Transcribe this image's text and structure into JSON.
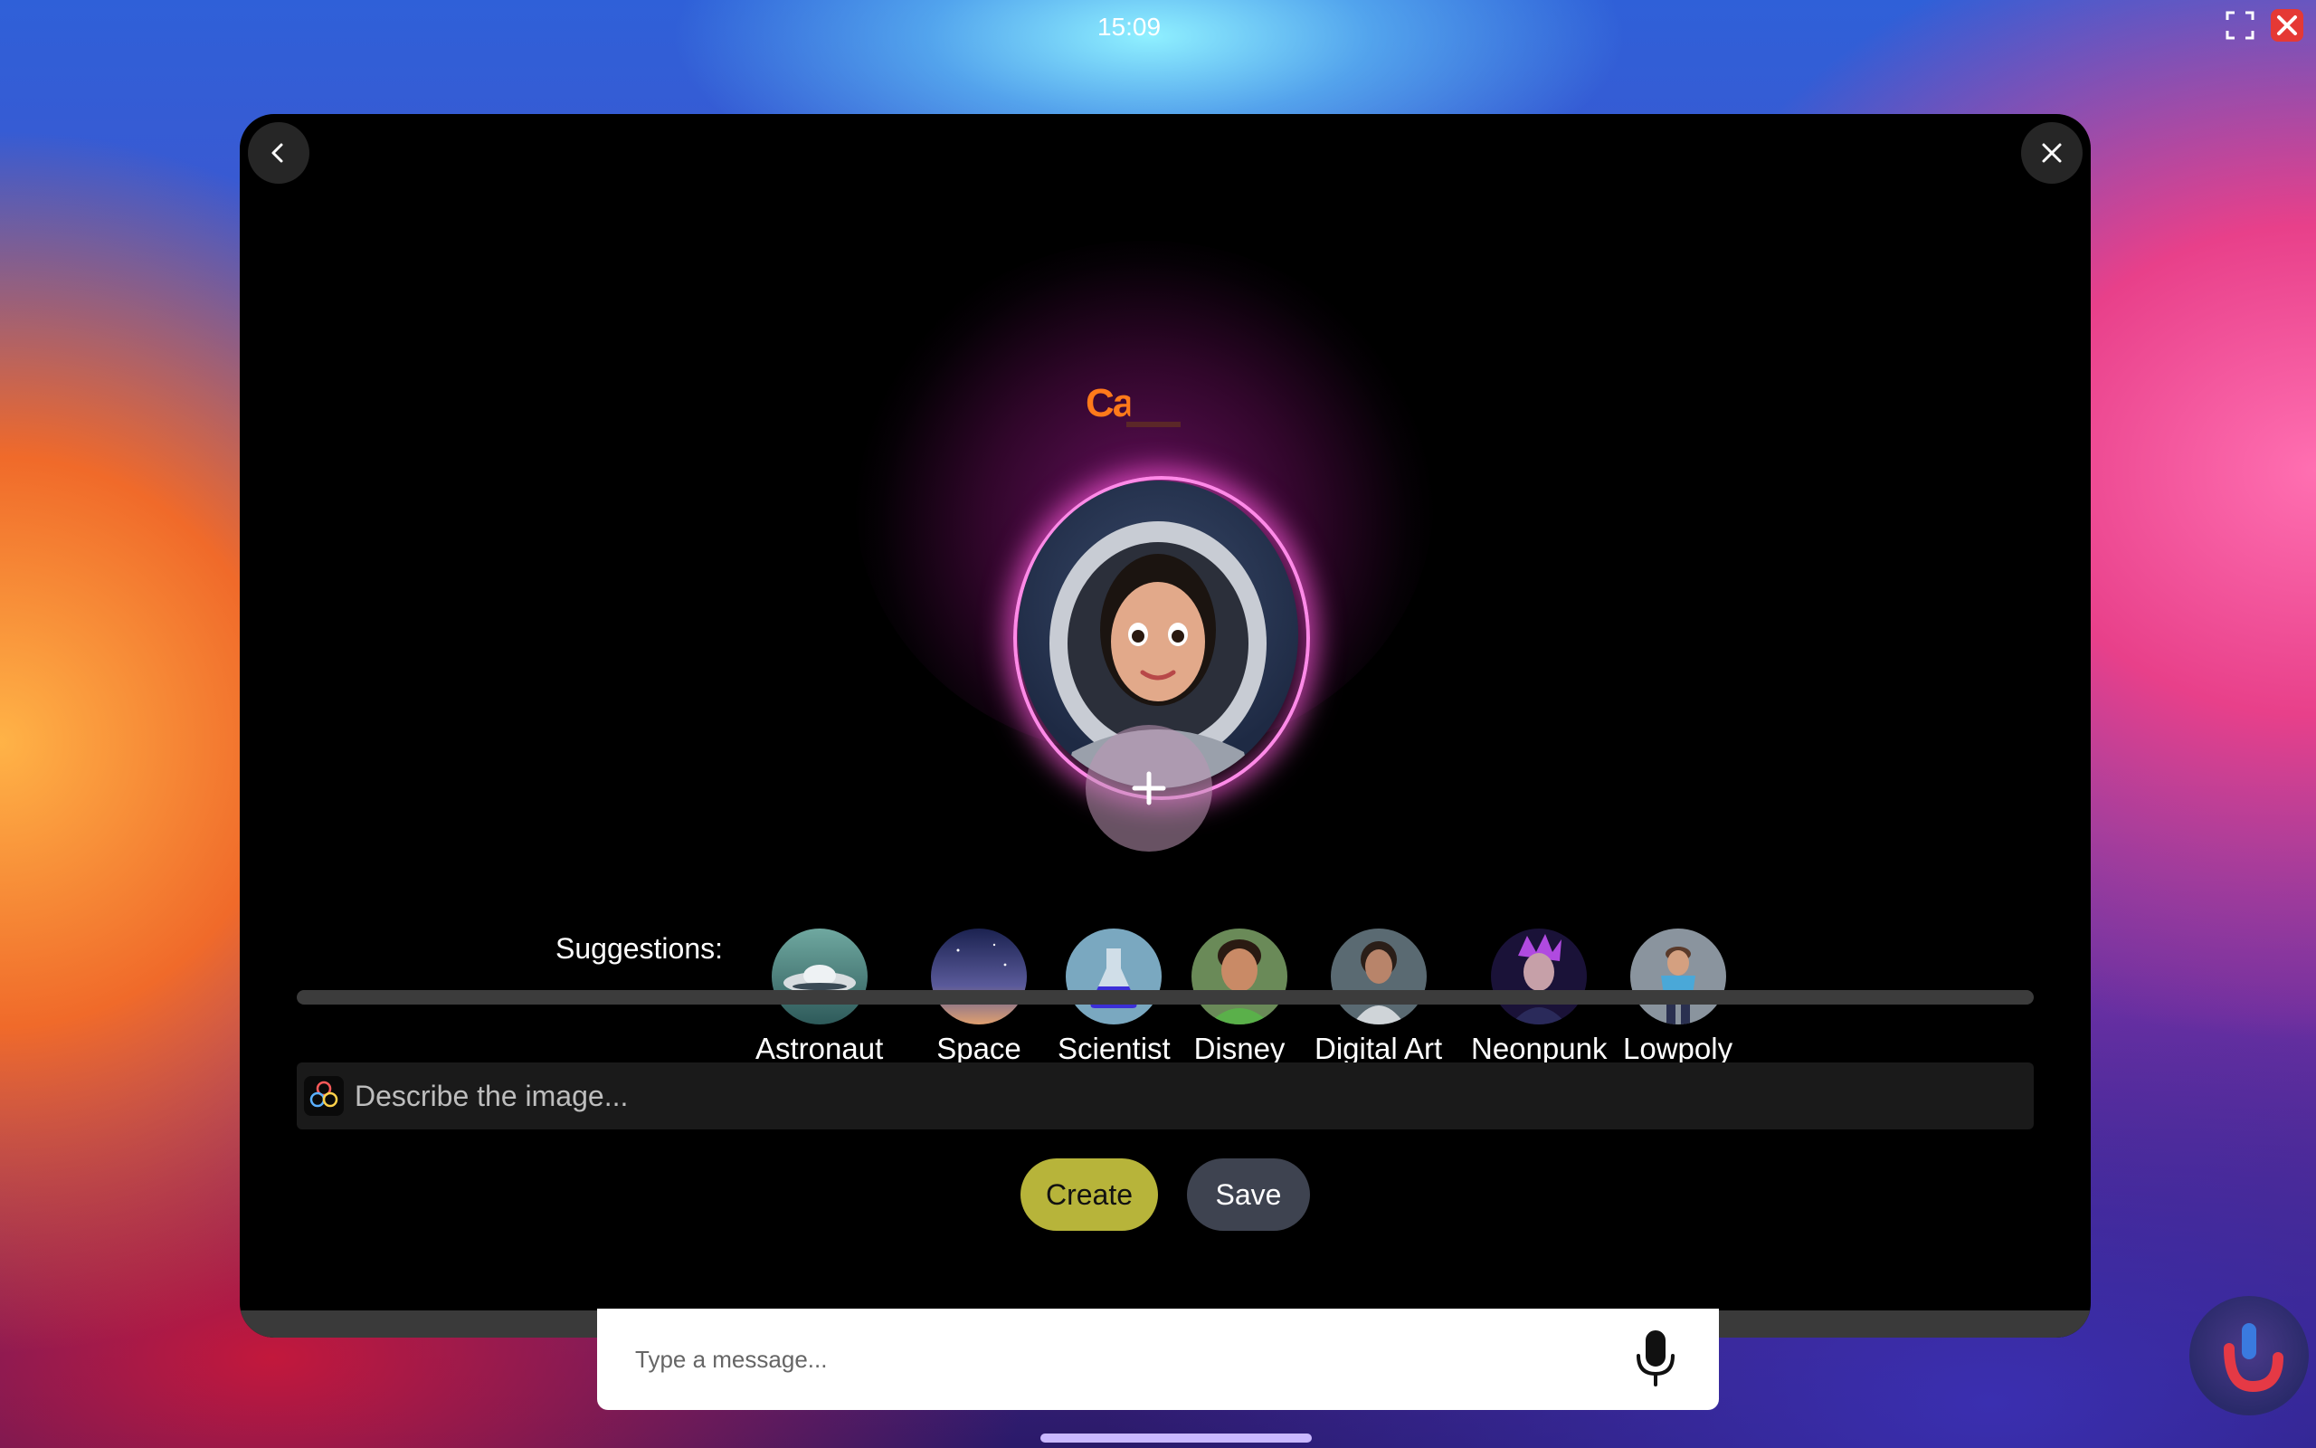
{
  "status_bar": {
    "time": "15:09"
  },
  "hero": {
    "logo_text": "Calc"
  },
  "suggestions": {
    "label": "Suggestions:",
    "items": [
      {
        "label": "Astronaut"
      },
      {
        "label": "Space"
      },
      {
        "label": "Scientist"
      },
      {
        "label": "Disney"
      },
      {
        "label": "Digital Art"
      },
      {
        "label": "Neonpunk"
      },
      {
        "label": "Lowpoly"
      }
    ]
  },
  "prompt": {
    "placeholder": "Describe the image..."
  },
  "actions": {
    "create_label": "Create",
    "save_label": "Save"
  },
  "chat": {
    "placeholder": "Type a message..."
  },
  "colors": {
    "create_button": "#b7b43a",
    "save_button": "#3e4350",
    "ring_glow": "#ff8ae8",
    "window_bg": "#000000"
  },
  "icons": {
    "fullscreen": "fullscreen-icon",
    "system_close": "close-icon",
    "back": "chevron-left-icon",
    "window_close": "close-icon",
    "add_photo": "plus-icon",
    "prompt": "sparkle-icon",
    "mic": "microphone-icon",
    "assistant": "assistant-icon"
  }
}
